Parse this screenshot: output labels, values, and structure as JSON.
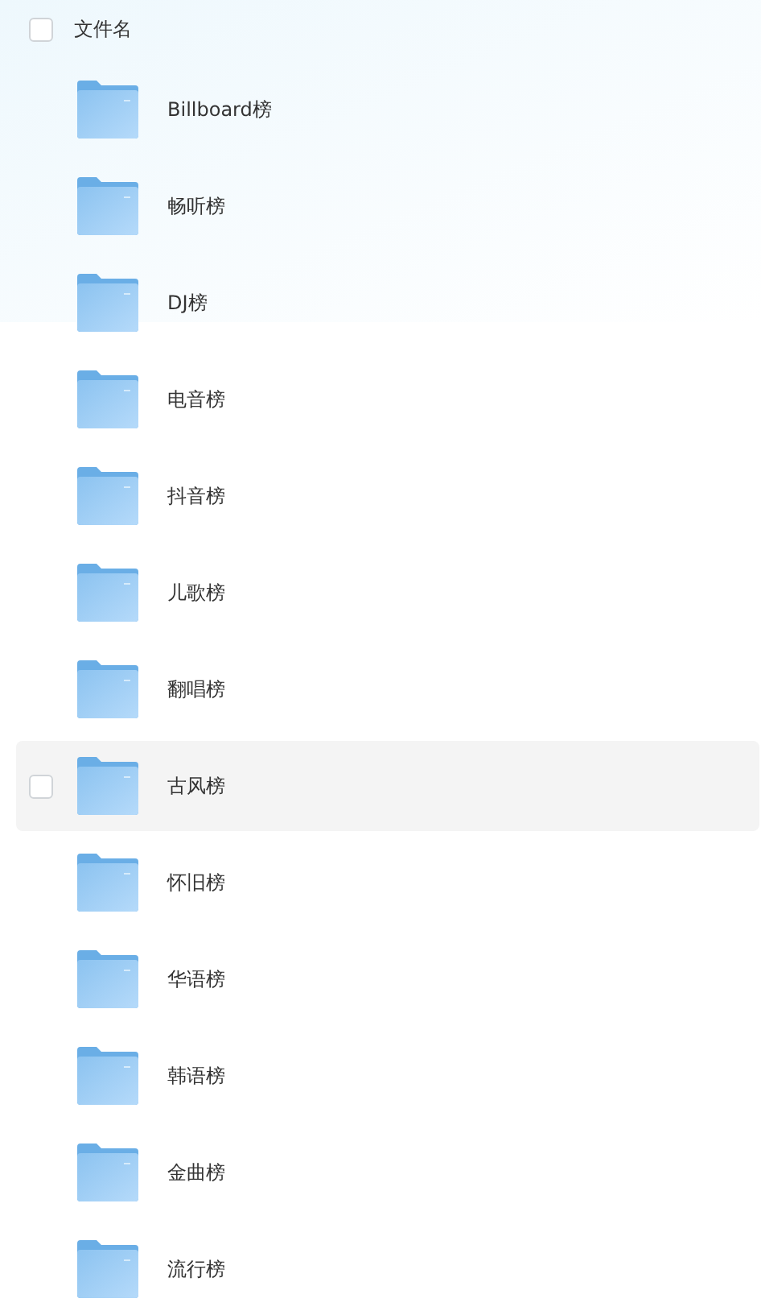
{
  "header": {
    "label": "文件名",
    "checked": false
  },
  "files": [
    {
      "name": "Billboard榜",
      "hovered": false
    },
    {
      "name": "畅听榜",
      "hovered": false
    },
    {
      "name": "DJ榜",
      "hovered": false
    },
    {
      "name": "电音榜",
      "hovered": false
    },
    {
      "name": "抖音榜",
      "hovered": false
    },
    {
      "name": "儿歌榜",
      "hovered": false
    },
    {
      "name": "翻唱榜",
      "hovered": false
    },
    {
      "name": "古风榜",
      "hovered": true
    },
    {
      "name": "怀旧榜",
      "hovered": false
    },
    {
      "name": "华语榜",
      "hovered": false
    },
    {
      "name": "韩语榜",
      "hovered": false
    },
    {
      "name": "金曲榜",
      "hovered": false
    },
    {
      "name": "流行榜",
      "hovered": false
    }
  ]
}
